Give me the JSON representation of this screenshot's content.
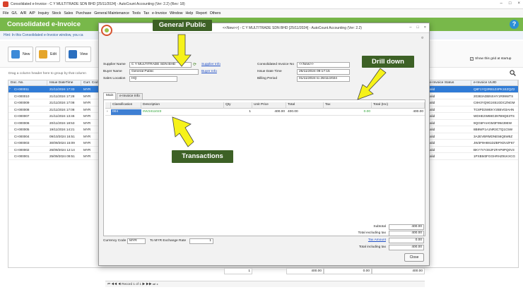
{
  "window": {
    "title": "Consolidated e-Invoice - C Y MULTITRADE SDN BHD [25/11/2024] - AutoCount Accounting (Ver: 2.2) (Rev: 18)",
    "controls": [
      "–",
      "□",
      "×"
    ]
  },
  "menu": [
    "File",
    "G/L",
    "A/R",
    "A/P",
    "Inquiry",
    "Stock",
    "Sales",
    "Purchase",
    "General Maintenance",
    "Tools",
    "Tax",
    "e-Invoice",
    "Window",
    "Help",
    "Report",
    "Others"
  ],
  "header": {
    "title": "Consolidated e-Invoice",
    "help_icon": "?"
  },
  "hint": "Hint: In this Consolidated e-Invoice window, you ca",
  "toolbar": {
    "new": "New",
    "edit": "Edit",
    "view": "View"
  },
  "show_grid_label": "Show this grid at startup",
  "group_hint": "Drag a column header here to group by that column",
  "grid": {
    "columns": [
      "Doc. No.",
      "Issue DateTime",
      "Curr. Cod",
      "e-Invoice Status",
      "e-Invoice UUID"
    ],
    "rows": [
      [
        "CI-000011",
        "21/11/2024 17:33",
        "MYR",
        "alid",
        "Q8F1YQ3RB1Z4PK1EZQZ2"
      ],
      [
        "CI-000010",
        "21/11/2024 17:28",
        "MYR",
        "alid",
        "20383ADBNSHY1R99WTS"
      ],
      [
        "CI-000009",
        "21/11/2024 17:08",
        "MYR",
        "alid",
        "C8H3YQ9G2451GDCZNGM"
      ],
      [
        "CI-000008",
        "21/11/2024 17:08",
        "MYR",
        "alid",
        "TC8PD3WEKY2B5V03AHN"
      ],
      [
        "CI-000007",
        "21/11/2024 13:46",
        "MYR",
        "alid",
        "WDHE2W88G397B9QE3TS"
      ],
      [
        "CI-000006",
        "20/11/2024 18:53",
        "MYR",
        "alid",
        "9QG5FAHGM3F99439EW"
      ],
      [
        "CI-000005",
        "19/11/2024 14:21",
        "MYR",
        "alid",
        "8B8WF1A1NR3CTQ1C5W"
      ],
      [
        "CI-000004",
        "09/10/2024 16:51",
        "MYR",
        "alid",
        "3A2EVBRMDNE56Q5W5Z"
      ],
      [
        "CI-000003",
        "30/09/2024 15:09",
        "MYR",
        "alid",
        "JW3F9H691DZBPXDVZF67"
      ],
      [
        "CI-000002",
        "26/09/2024 12:14",
        "MYR",
        "alid",
        "BKY7VY3S2FZFAP8PQ0V3"
      ],
      [
        "CI-000001",
        "25/09/2024 09:51",
        "MYR",
        "alid",
        "1PXBM3FGGHRHZ91KXCG"
      ]
    ]
  },
  "dialog": {
    "title": "<<New>>] - C Y MULTITRADE SDN BHD [25/11/2024] - AutoCount Accounting (Ver: 2.2)",
    "controls": [
      "–",
      "□",
      "×"
    ],
    "sub_marker": "¤",
    "supplier_name_label": "Supplier Name",
    "supplier_name": "C Y MULTITRADE SDN BHD",
    "supplier_info_link": "Supplier Info",
    "buyer_name_label": "Buyer Name",
    "buyer_name": "General Public",
    "buyer_info_link": "Buyer Info",
    "sales_location_label": "Sales Location",
    "sales_location": "HQ",
    "consolidated_no_label": "Consolidated Invoice No",
    "consolidated_no": "<<New>>",
    "issue_datetime_label": "Issue Date Time",
    "issue_datetime": "26/11/2024 09:17:15",
    "billing_period_label": "Billing Period",
    "billing_period": "01/11/2024 to 26/11/2024",
    "tabs": [
      "Main",
      "e-Invoice Info"
    ],
    "detail_columns": [
      "Classification",
      "Description",
      "Qty",
      "Unit Price",
      "Total",
      "Tax",
      "Total (Inc)"
    ],
    "detail_row": {
      "classification": "004",
      "description": "INV2411023",
      "qty": "1",
      "unit_price": "400.00",
      "total": "400.00",
      "tax": "0.00",
      "total_inc": "400.00"
    },
    "footer_totals": {
      "qty": "1",
      "total": "400.00",
      "tax": "0.00",
      "total_inc": "400.00"
    },
    "nav_text": "⏮ ◀◀ ◀  Record 1 of 1  ▶ ▶▶ ⏭  ◂",
    "currency_code_label": "Currency Code",
    "currency_code": "MYR",
    "exchange_rate_label": "To MYR Exchange Rate",
    "exchange_rate": "1",
    "subtotal_label": "Subtotal",
    "subtotal": "400.00",
    "total_excl_label": "Total excluding tax",
    "total_excl": "400.00",
    "tax_amount_label": "Tax Amount",
    "tax_amount": "0.00",
    "total_incl_label": "Total including tax",
    "total_incl": "400.00",
    "close_label": "Close"
  },
  "annotations": {
    "general_public": "General Public",
    "drill_down": "Drill down",
    "transactions": "Transactions",
    "arrow_color": "#f6f21a",
    "callout_color": "#3d6126"
  }
}
